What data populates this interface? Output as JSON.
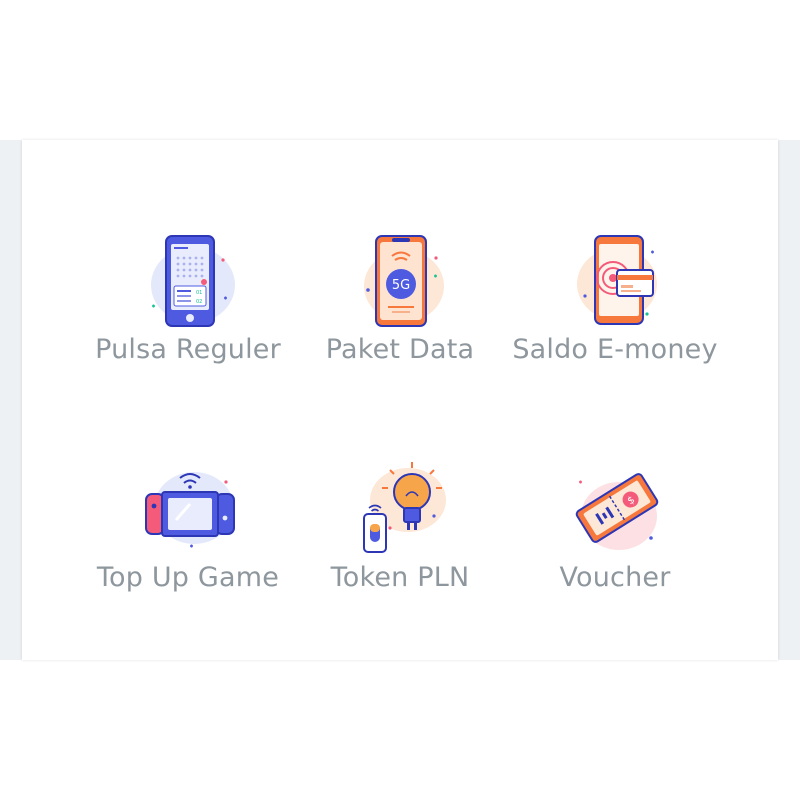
{
  "accent_colors": {
    "label_text": "#8e979d",
    "card_background": "#ffffff",
    "page_background": "#eef1f4"
  },
  "menu": {
    "items": [
      {
        "label": "Pulsa Reguler",
        "icon": "phone-keypad-icon"
      },
      {
        "label": "Paket Data",
        "icon": "phone-5g-icon"
      },
      {
        "label": "Saldo E-money",
        "icon": "emoney-card-icon"
      },
      {
        "label": "Top Up Game",
        "icon": "game-console-icon"
      },
      {
        "label": "Token PLN",
        "icon": "lightbulb-icon"
      },
      {
        "label": "Voucher",
        "icon": "voucher-ticket-icon"
      }
    ]
  },
  "icon_text": {
    "data_badge": "5G"
  }
}
